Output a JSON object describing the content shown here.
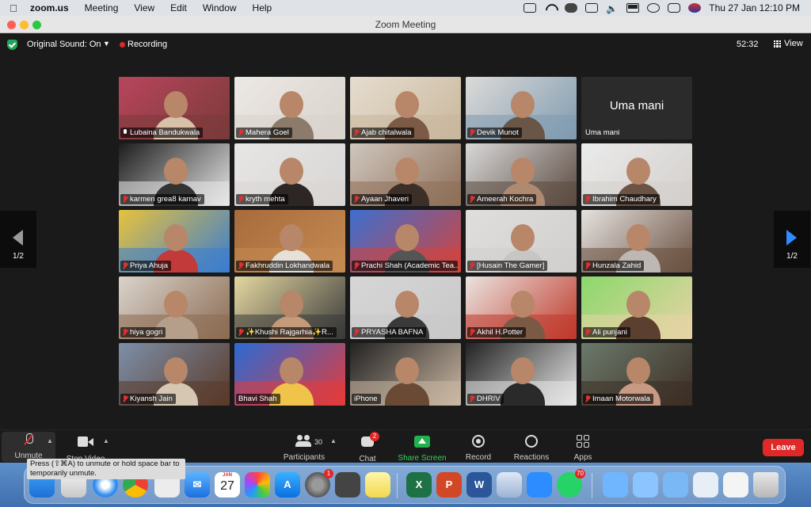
{
  "menubar": {
    "app_name": "zoom.us",
    "menus": [
      "Meeting",
      "View",
      "Edit",
      "Window",
      "Help"
    ],
    "clock": "Thu 27 Jan  12:10 PM",
    "icons": [
      "apple-icon",
      "zoom-status-icon",
      "wifi-icon",
      "cloud-icon",
      "display-icon",
      "volume-icon",
      "battery-icon",
      "spotlight-search-icon",
      "control-center-icon",
      "siri-icon"
    ]
  },
  "window": {
    "title": "Zoom Meeting"
  },
  "topbar": {
    "original_sound": "Original Sound: On",
    "recording": "Recording",
    "timer": "52:32",
    "view": "View"
  },
  "pagination": {
    "left_page": "1/2",
    "right_page": "1/2"
  },
  "accent_colors": {
    "active_speaker_border": "#4ac54a",
    "leave": "#e02828",
    "share": "#22b14c",
    "next_arrow": "#2d8cff"
  },
  "participants": [
    {
      "name": "Lubaina Bandukwala",
      "muted": false,
      "active": true
    },
    {
      "name": "Mahera Goel",
      "muted": true
    },
    {
      "name": "Ajab chitalwala",
      "muted": true
    },
    {
      "name": "Devik Munot",
      "muted": true
    },
    {
      "name": "Uma mani",
      "muted": false,
      "video_off": true
    },
    {
      "name": "karmen grea8 karnav",
      "muted": true
    },
    {
      "name": "kryth mehta",
      "muted": true
    },
    {
      "name": "Ayaan Jhaveri",
      "muted": true
    },
    {
      "name": "Ameerah Kochra",
      "muted": true
    },
    {
      "name": "Ibrahim Chaudhary",
      "muted": true
    },
    {
      "name": "Priya Ahuja",
      "muted": true
    },
    {
      "name": "Fakhruddin Lokhandwala",
      "muted": true
    },
    {
      "name": "Prachi Shah (Academic Tea...",
      "muted": true
    },
    {
      "name": "[Husain The Gamer]",
      "muted": true
    },
    {
      "name": "Hunzala Zahid",
      "muted": true
    },
    {
      "name": "hiya gogri",
      "muted": true
    },
    {
      "name": "✨Khushi Rajgarhia✨R...",
      "muted": true
    },
    {
      "name": "PRYASHA  BAFNA",
      "muted": true
    },
    {
      "name": "Akhil H.Potter",
      "muted": true
    },
    {
      "name": "Ali punjani",
      "muted": true
    },
    {
      "name": "Kiyansh Jain",
      "muted": true
    },
    {
      "name": "Bhavi Shah",
      "muted": false,
      "no_icon": true
    },
    {
      "name": "iPhone",
      "muted": false,
      "no_icon": true
    },
    {
      "name": "DHRIV",
      "muted": true
    },
    {
      "name": "Imaan Motorwala",
      "muted": true
    }
  ],
  "uma_display": "Uma mani",
  "toolbar": {
    "unmute": "Unmute",
    "stop_video": "Stop Video",
    "participants": "Participants",
    "participants_count": "30",
    "chat": "Chat",
    "chat_badge": "2",
    "share_screen": "Share Screen",
    "record": "Record",
    "reactions": "Reactions",
    "apps": "Apps",
    "leave": "Leave"
  },
  "tooltip": {
    "line1": "Press  (⇧⌘A) to unmute or hold space bar to",
    "line2": "temporarily unmute."
  },
  "dock": {
    "calendar_month": "JAN",
    "calendar_day": "27",
    "settings_badge": "1",
    "whatsapp_badge": "70"
  }
}
